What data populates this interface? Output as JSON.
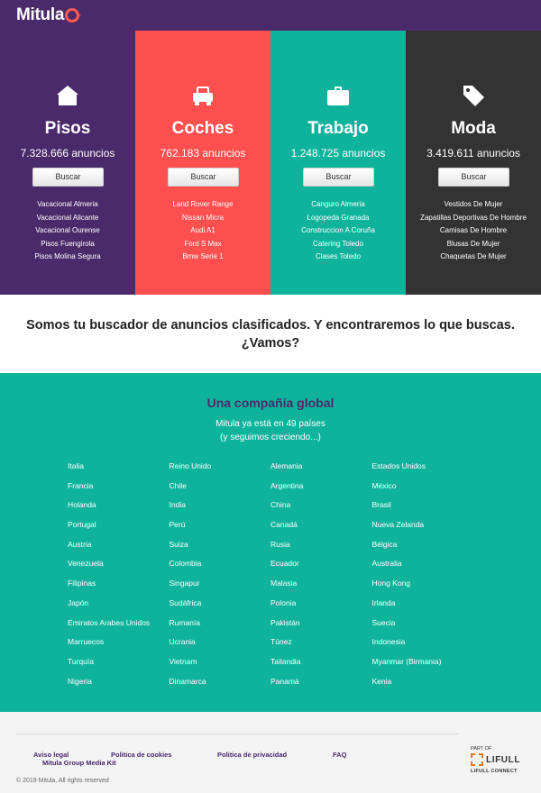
{
  "header": {
    "logo_text": "Mitula"
  },
  "categories": [
    {
      "title": "Pisos",
      "count": "7.328.666 anuncios",
      "button": "Buscar",
      "links": [
        "Vacacional Almeria",
        "Vacacional Alicante",
        "Vacacional Ourense",
        "Pisos Fuengirola",
        "Pisos Molina Segura"
      ],
      "color": "#4b2a6b",
      "icon": "house-icon"
    },
    {
      "title": "Coches",
      "count": "762.183 anuncios",
      "button": "Buscar",
      "links": [
        "Land Rover Range",
        "Nissan Micra",
        "Audi A1",
        "Ford S Max",
        "Bmw Serie 1"
      ],
      "color": "#ff4f4f",
      "icon": "car-icon"
    },
    {
      "title": "Trabajo",
      "count": "1.248.725 anuncios",
      "button": "Buscar",
      "links": [
        "Canguro Almeria",
        "Logopeda Granada",
        "Construccion A Coruña",
        "Catering Toledo",
        "Clases Toledo"
      ],
      "color": "#0fb39b",
      "icon": "briefcase-icon"
    },
    {
      "title": "Moda",
      "count": "3.419.611 anuncios",
      "button": "Buscar",
      "links": [
        "Vestidos De Mujer",
        "Zapatillas Deportivas De Hombre",
        "Camisas De Hombre",
        "Blusas De Mujer",
        "Chaquetas De Mujer"
      ],
      "color": "#333333",
      "icon": "tag-icon"
    }
  ],
  "tagline": "Somos tu buscador de anuncios clasificados. Y encontraremos lo que buscas. ¿Vamos?",
  "global": {
    "title": "Una compañía global",
    "subtitle_line1": "Mitula ya está en 49 países",
    "subtitle_line2": "(y seguimos creciendo...)",
    "countries": [
      "Italia",
      "Reino Unido",
      "Alemania",
      "Estados Unidos",
      "Francia",
      "Chile",
      "Argentina",
      "México",
      "Holanda",
      "India",
      "China",
      "Brasil",
      "Portugal",
      "Perú",
      "Canadá",
      "Nueva Zelanda",
      "Austria",
      "Suiza",
      "Rusia",
      "Bélgica",
      "Venezuela",
      "Colombia",
      "Ecuador",
      "Australia",
      "Filipinas",
      "Singapur",
      "Malasia",
      "Hong Kong",
      "Japón",
      "Sudáfrica",
      "Polonia",
      "Irlanda",
      "Emiratos Arabes Unidos",
      "Rumanía",
      "Pakistán",
      "Suecia",
      "Marruecos",
      "Ucrania",
      "Túnez",
      "Indonesia",
      "Turquía",
      "Vietnam",
      "Tailandia",
      "Myanmar (Birmania)",
      "Nigeria",
      "Dinamarca",
      "Panamá",
      "Kenia"
    ]
  },
  "footer": {
    "aviso_legal": "Aviso legal",
    "cookies": "Politica de cookies",
    "privacidad": "Politica de privacidad",
    "faq": "FAQ",
    "media_kit": "Mitula Group Media Kit",
    "copyright": "© 2019 Mitula, All rights reserved",
    "partof": "PART OF",
    "brand": "LIFULL",
    "connect": "LIFULL CONNECT"
  },
  "colors": {
    "purple": "#4b2a6b",
    "coral": "#ff4f4f",
    "teal": "#0fb39b",
    "dark": "#333333",
    "orange": "#f07a1a"
  }
}
